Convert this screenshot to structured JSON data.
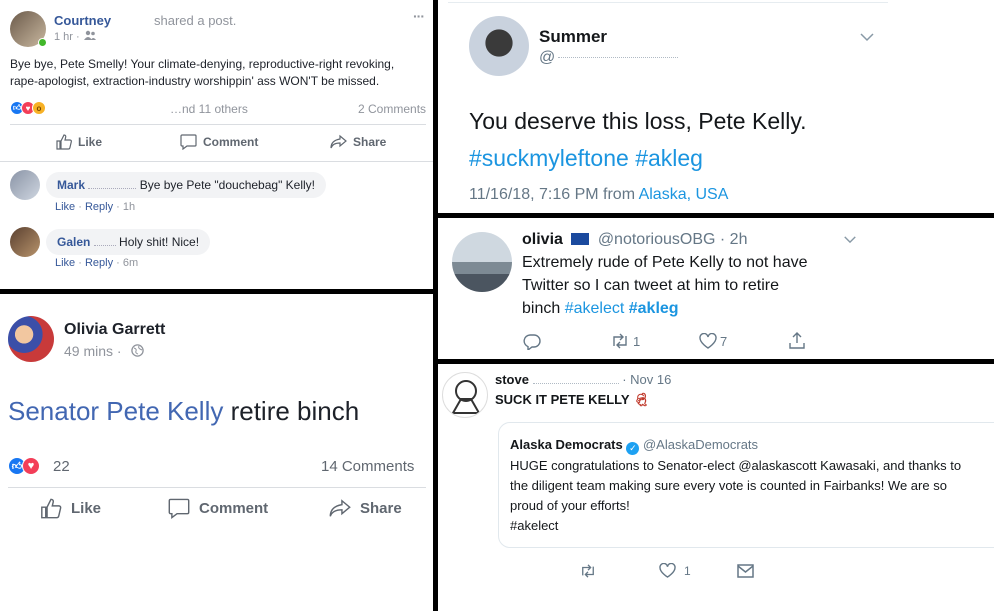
{
  "fb_post_1": {
    "author": "Courtney",
    "action": "shared a post.",
    "time": "1 hr ·",
    "more": "···",
    "text_line_1": "Bye bye, Pete Smelly! Your climate-denying, reproductive-right revoking,",
    "text_line_2": "rape-apologist, extraction-industry worshippin' ass WON'T be missed.",
    "reactions_text": "…nd 11 others",
    "comments_count": "2 Comments",
    "like_label": "Like",
    "comment_label": "Comment",
    "share_label": "Share",
    "comments": [
      {
        "author": "Mark",
        "text": "Bye bye Pete \"douchebag\" Kelly!",
        "like": "Like",
        "reply": "Reply",
        "time": "1h",
        "sep": "·"
      },
      {
        "author": "Galen",
        "text": "Holy shit! Nice!",
        "like": "Like",
        "reply": "Reply",
        "time": "6m",
        "sep": "·"
      }
    ]
  },
  "fb_post_2": {
    "author": "Olivia Garrett",
    "time": "49 mins ·",
    "text_link": "Senator Pete Kelly",
    "text_rest": " retire binch",
    "reaction_count": "22",
    "comments_count": "14 Comments",
    "like_label": "Like",
    "comment_label": "Comment",
    "share_label": "Share"
  },
  "tweet_1": {
    "name": "Summer",
    "handle": "@",
    "text": "You deserve this loss, Pete Kelly.",
    "hashtags": "#suckmyleftone #akleg",
    "timestamp": "11/16/18, 7:16 PM from ",
    "location": "Alaska, USA"
  },
  "tweet_2": {
    "name": "olivia",
    "handle": "@notoriousOBG",
    "time": "· 2h",
    "text_line_1": "Extremely rude of Pete Kelly to not have",
    "text_line_2": "Twitter so I can tweet at him to retire",
    "text_line_3_plain": "binch ",
    "hashtag_1": "#akelect",
    "hashtag_2": "#akleg",
    "retweets": "1",
    "likes": "7"
  },
  "tweet_3": {
    "name": "stove",
    "handle_time": "· Nov 16",
    "text": "SUCK IT PETE KELLY",
    "quoted_name": "Alaska Democrats",
    "quoted_handle": "@AlaskaDemocrats",
    "quoted_line_1": "HUGE congratulations to Senator-elect @alaskascott Kawasaki, and thanks to",
    "quoted_line_2": "the diligent team making sure every vote is counted in Fairbanks! We are so",
    "quoted_line_3": "proud of your efforts!",
    "quoted_line_4": "#akelect",
    "likes": "1"
  },
  "colors": {
    "fb_blue": "#365899",
    "tw_blue": "#1b95e0",
    "like_blue": "#1877f2",
    "love_red": "#f33e58",
    "divider": "#000000"
  }
}
